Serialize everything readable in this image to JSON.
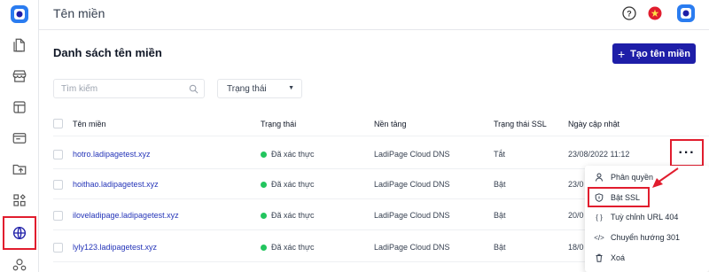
{
  "header": {
    "title": "Tên miền"
  },
  "main": {
    "page_title": "Danh sách tên miền",
    "add_button": "Tạo tên miền",
    "search_placeholder": "Tìm kiếm",
    "status_filter": "Trạng thái"
  },
  "table": {
    "columns": [
      "Tên miền",
      "Trạng thái",
      "Nền tảng",
      "Trạng thái SSL",
      "Ngày cập nhật"
    ],
    "rows": [
      {
        "domain": "hotro.ladipagetest.xyz",
        "status": "Đã xác thực",
        "platform": "LadiPage Cloud DNS",
        "ssl": "Tắt",
        "updated": "23/08/2022 11:12"
      },
      {
        "domain": "hoithao.ladipagetest.xyz",
        "status": "Đã xác thực",
        "platform": "LadiPage Cloud DNS",
        "ssl": "Bật",
        "updated": "23/0"
      },
      {
        "domain": "iloveladipage.ladipagetest.xyz",
        "status": "Đã xác thực",
        "platform": "LadiPage Cloud DNS",
        "ssl": "Bật",
        "updated": "20/0"
      },
      {
        "domain": "lyly123.ladipagetest.xyz",
        "status": "Đã xác thực",
        "platform": "LadiPage Cloud DNS",
        "ssl": "Bật",
        "updated": "18/0"
      }
    ]
  },
  "more_button": "···",
  "menu": {
    "items": [
      {
        "label": "Phân quyền",
        "icon": "user-icon"
      },
      {
        "label": "Bật SSL",
        "icon": "shield-icon"
      },
      {
        "label": "Tuỳ chỉnh URL 404",
        "icon": "braces-icon"
      },
      {
        "label": "Chuyển hướng 301",
        "icon": "code-icon"
      },
      {
        "label": "Xoá",
        "icon": "trash-icon"
      }
    ]
  },
  "colors": {
    "accent": "#1e1ea8",
    "highlight": "#e11d2e",
    "verified": "#22c55e",
    "link": "#2434b8"
  }
}
